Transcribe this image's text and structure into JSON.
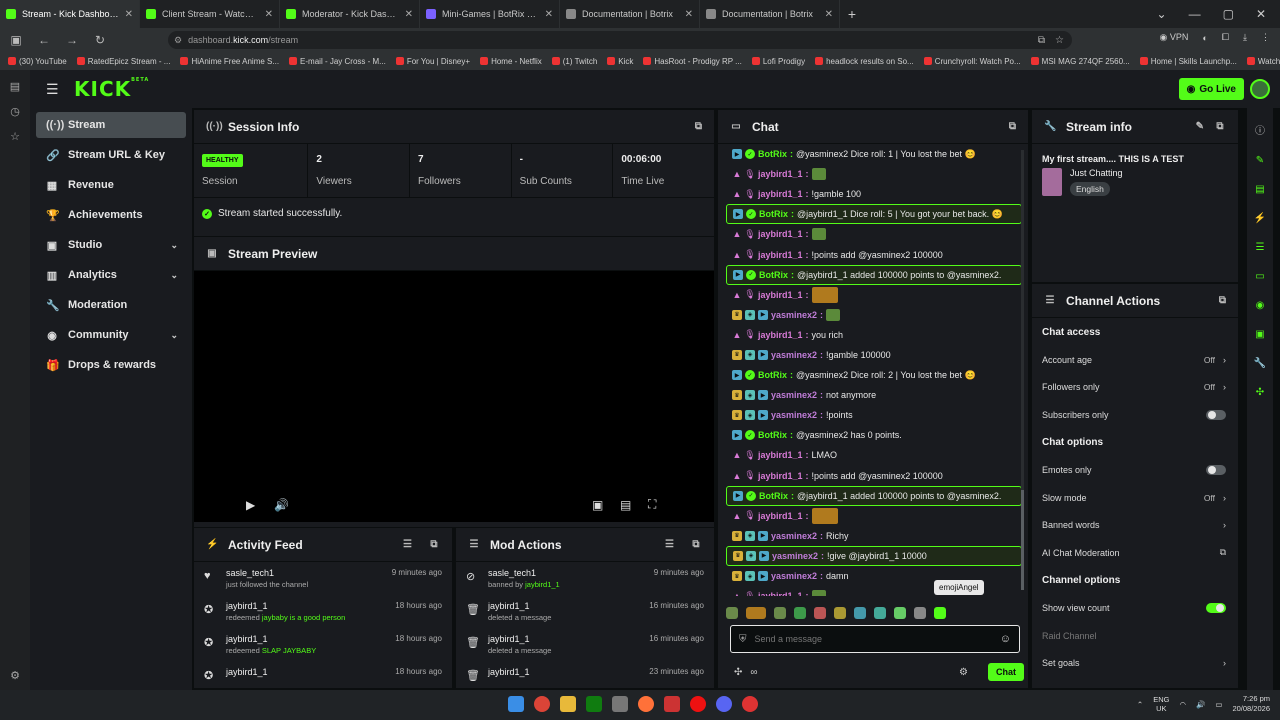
{
  "browser": {
    "tabs": [
      {
        "title": "Stream - Kick Dashboard",
        "fav": "kick",
        "active": true
      },
      {
        "title": "Client Stream - Watch Live on K",
        "fav": "kick"
      },
      {
        "title": "Moderator - Kick Dashboard",
        "fav": "kick"
      },
      {
        "title": "Mini-Games | BotRix — Cloud S",
        "fav": "botrix"
      },
      {
        "title": "Documentation | Botrix",
        "fav": "doc"
      },
      {
        "title": "Documentation | Botrix",
        "fav": "doc"
      }
    ],
    "url_prefix": "dashboard.",
    "url_host": "kick.com",
    "url_path": "/stream",
    "vpn_label": "VPN",
    "bookmarks": [
      "(30) YouTube",
      "RatedEpicz Stream - ...",
      "HiAnime Free Anime S...",
      "E-mail - Jay Cross - M...",
      "For You | Disney+",
      "Home - Netflix",
      "(1) Twitch",
      "Kick",
      "HasRoot - Prodigy RP ...",
      "Lofi Prodigy",
      "headlock results on So...",
      "Crunchyroll: Watch Po...",
      "MSI MAG 274QF 2560...",
      "Home | Skills Launchp...",
      "Watch Sword Art Onli..."
    ]
  },
  "app": {
    "logo": "KICK",
    "logo_sup": "BETA",
    "go_live": "Go Live"
  },
  "nav": [
    {
      "label": "Stream",
      "icon": "stream-icon",
      "glyph": "((·))",
      "active": true
    },
    {
      "label": "Stream URL & Key",
      "icon": "link-icon",
      "glyph": "🔗"
    },
    {
      "label": "Revenue",
      "icon": "revenue-icon",
      "glyph": "▦"
    },
    {
      "label": "Achievements",
      "icon": "trophy-icon",
      "glyph": "🏆"
    },
    {
      "label": "Studio",
      "icon": "studio-icon",
      "glyph": "▣",
      "chevron": true
    },
    {
      "label": "Analytics",
      "icon": "analytics-icon",
      "glyph": "▥",
      "chevron": true
    },
    {
      "label": "Moderation",
      "icon": "wrench-icon",
      "glyph": "🔧"
    },
    {
      "label": "Community",
      "icon": "community-icon",
      "glyph": "◉",
      "chevron": true
    },
    {
      "label": "Drops & rewards",
      "icon": "gift-icon",
      "glyph": "🎁"
    }
  ],
  "session": {
    "title": "Session Info",
    "health": "HEALTHY",
    "health_label": "Session",
    "viewers": "2",
    "viewers_label": "Viewers",
    "followers": "7",
    "followers_label": "Followers",
    "subs": "-",
    "subs_label": "Sub Counts",
    "time": "00:06:00",
    "time_label": "Time Live",
    "status": "Stream started successfully."
  },
  "preview": {
    "title": "Stream Preview"
  },
  "activity": {
    "title": "Activity Feed",
    "items": [
      {
        "user": "sasle_tech1",
        "desc": "just followed the channel",
        "hl": "",
        "time": "9 minutes ago",
        "icon": "heart-icon",
        "glyph": "♥"
      },
      {
        "user": "jaybird1_1",
        "desc": "redeemed ",
        "hl": "jaybaby is a good person",
        "time": "18 hours ago",
        "icon": "reward-icon",
        "glyph": "✪"
      },
      {
        "user": "jaybird1_1",
        "desc": "redeemed ",
        "hl": "SLAP JAYBABY",
        "time": "18 hours ago",
        "icon": "reward-icon",
        "glyph": "✪"
      },
      {
        "user": "jaybird1_1",
        "desc": "",
        "hl": "",
        "time": "18 hours ago",
        "icon": "reward-icon",
        "glyph": "✪"
      }
    ]
  },
  "modactions": {
    "title": "Mod Actions",
    "items": [
      {
        "user": "sasle_tech1",
        "desc": "banned by ",
        "hl": "jaybird1_1",
        "time": "9 minutes ago",
        "icon": "ban-icon",
        "glyph": "⊘"
      },
      {
        "user": "jaybird1_1",
        "desc": "deleted a message",
        "hl": "",
        "time": "16 minutes ago",
        "icon": "trash-icon",
        "glyph": "🗑"
      },
      {
        "user": "jaybird1_1",
        "desc": "deleted a message",
        "hl": "",
        "time": "16 minutes ago",
        "icon": "trash-icon",
        "glyph": "🗑"
      },
      {
        "user": "jaybird1_1",
        "desc": "",
        "hl": "",
        "time": "23 minutes ago",
        "icon": "trash-icon",
        "glyph": "🗑"
      }
    ]
  },
  "chat": {
    "title": "Chat",
    "messages": [
      {
        "user": "BotRix",
        "text": "@yasminex2 Dice roll: 1 | You lost the bet 😊",
        "type": "bot"
      },
      {
        "user": "jaybird1_1",
        "text": "",
        "type": "jay",
        "emote": "small"
      },
      {
        "user": "jaybird1_1",
        "text": "!gamble 100",
        "type": "jay"
      },
      {
        "user": "BotRix",
        "text": "@jaybird1_1 Dice roll: 5 | You got your bet back. 😊",
        "type": "bot",
        "hl": true
      },
      {
        "user": "jaybird1_1",
        "text": "",
        "type": "jay",
        "emote": "small"
      },
      {
        "user": "jaybird1_1",
        "text": "!points add @yasminex2 100000",
        "type": "jay"
      },
      {
        "user": "BotRix",
        "text": "@jaybird1_1 added 100000 points to @yasminex2.",
        "type": "bot",
        "hl": true
      },
      {
        "user": "jaybird1_1",
        "text": "",
        "type": "jay",
        "emote": "big"
      },
      {
        "user": "yasminex2",
        "text": "",
        "type": "yas",
        "emote": "small"
      },
      {
        "user": "jaybird1_1",
        "text": "you rich",
        "type": "jay"
      },
      {
        "user": "yasminex2",
        "text": "!gamble 100000",
        "type": "yas"
      },
      {
        "user": "BotRix",
        "text": "@yasminex2 Dice roll: 2 | You lost the bet 😊",
        "type": "bot"
      },
      {
        "user": "yasminex2",
        "text": "not anymore",
        "type": "yas"
      },
      {
        "user": "yasminex2",
        "text": "!points",
        "type": "yas"
      },
      {
        "user": "BotRix",
        "text": "@yasminex2 has 0 points.",
        "type": "bot"
      },
      {
        "user": "jaybird1_1",
        "text": "LMAO",
        "type": "jay"
      },
      {
        "user": "jaybird1_1",
        "text": "!points add @yasminex2 100000",
        "type": "jay"
      },
      {
        "user": "BotRix",
        "text": "@jaybird1_1 added 100000 points to @yasminex2.",
        "type": "bot",
        "hl": true
      },
      {
        "user": "jaybird1_1",
        "text": "",
        "type": "jay",
        "emote": "big"
      },
      {
        "user": "yasminex2",
        "text": "Richy",
        "type": "yas"
      },
      {
        "user": "yasminex2",
        "text": "!give @jaybird1_1 10000",
        "type": "yas",
        "hl": true
      },
      {
        "user": "yasminex2",
        "text": "damn",
        "type": "yas"
      },
      {
        "user": "jaybird1_1",
        "text": "",
        "type": "jay",
        "emote": "small"
      }
    ],
    "tooltip": "emojiAngel",
    "input_placeholder": "Send a message",
    "send_label": "Chat"
  },
  "stream_info": {
    "title": "Stream info",
    "stream_title": "My first stream.... THIS IS A TEST",
    "category": "Just Chatting",
    "language": "English"
  },
  "channel_actions": {
    "title": "Channel Actions",
    "chat_access": "Chat access",
    "account_age": "Account age",
    "account_age_val": "Off",
    "followers_only": "Followers only",
    "followers_only_val": "Off",
    "subscribers_only": "Subscribers only",
    "chat_options": "Chat options",
    "emotes_only": "Emotes only",
    "slow_mode": "Slow mode",
    "slow_mode_val": "Off",
    "banned_words": "Banned words",
    "ai_moderation": "AI Chat Moderation",
    "channel_options": "Channel options",
    "show_view_count": "Show view count",
    "raid_channel": "Raid Channel",
    "set_goals": "Set goals",
    "toggles": {
      "subscribers_only": false,
      "emotes_only": false,
      "show_view_count": true
    }
  },
  "tray": {
    "lang1": "ENG",
    "lang2": "UK",
    "time": "7:26 pm",
    "date": "20/08/2026"
  },
  "colors": {
    "accent": "#53fc18",
    "panel": "#191b1f",
    "bg": "#0b0e0f"
  }
}
